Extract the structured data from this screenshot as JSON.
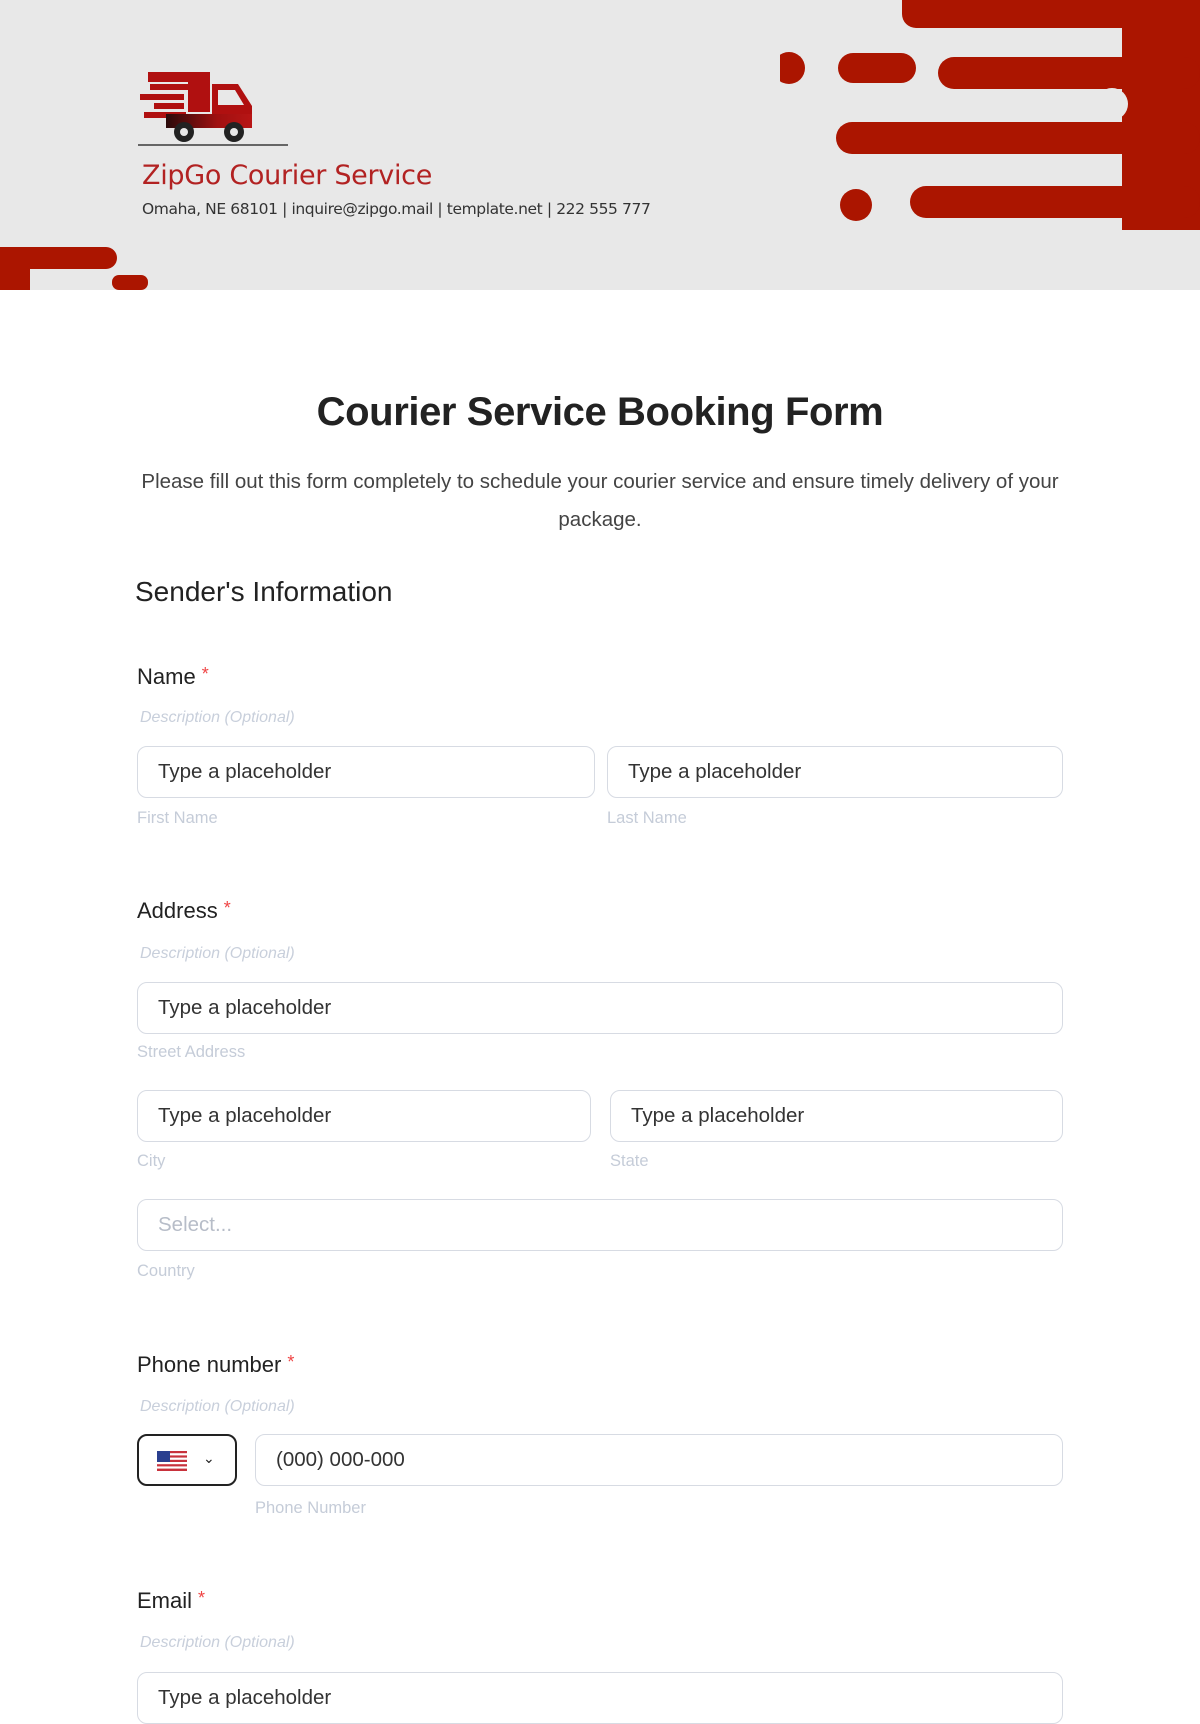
{
  "header": {
    "company_name": "ZipGo Courier Service",
    "contact_line": "Omaha, NE 68101 | inquire@zipgo.mail | template.net | 222 555 777",
    "brand_color": "#ab1500"
  },
  "form": {
    "title": "Courier Service Booking Form",
    "subtitle": "Please fill out this form completely to schedule your courier service and ensure timely delivery of your package.",
    "section_title": "Sender's Information",
    "required_marker": "*",
    "fields": {
      "name": {
        "label": "Name",
        "description": "Description (Optional)",
        "first": {
          "placeholder": "Type a placeholder",
          "sublabel": "First Name"
        },
        "last": {
          "placeholder": "Type a placeholder",
          "sublabel": "Last Name"
        }
      },
      "address": {
        "label": "Address",
        "description": "Description (Optional)",
        "street": {
          "placeholder": "Type a placeholder",
          "sublabel": "Street Address"
        },
        "city": {
          "placeholder": "Type a placeholder",
          "sublabel": "City"
        },
        "state": {
          "placeholder": "Type a placeholder",
          "sublabel": "State"
        },
        "country": {
          "placeholder": "Select...",
          "sublabel": "Country"
        }
      },
      "phone": {
        "label": "Phone number",
        "description": "Description (Optional)",
        "country_flag": "us-flag-icon",
        "placeholder": "(000) 000-000",
        "sublabel": "Phone Number"
      },
      "email": {
        "label": "Email",
        "description": "Description (Optional)",
        "placeholder": "Type a placeholder"
      }
    }
  }
}
